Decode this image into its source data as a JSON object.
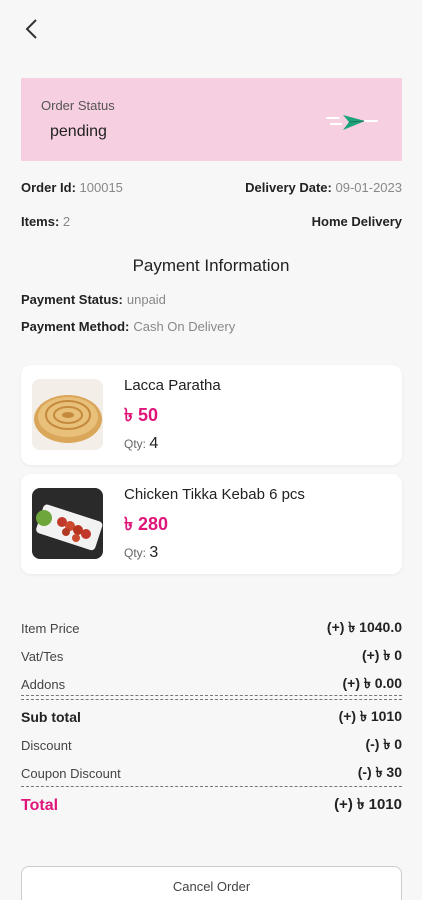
{
  "header": {
    "back_icon": "chevron-left-icon"
  },
  "status": {
    "label": "Order Status",
    "value": "pending",
    "icon": "paper-plane-icon"
  },
  "order": {
    "id_label": "Order Id:",
    "id_value": "100015",
    "date_label": "Delivery Date:",
    "date_value": "09-01-2023",
    "items_label": "Items:",
    "items_value": "2",
    "delivery_type": "Home Delivery"
  },
  "payment": {
    "title": "Payment Information",
    "status_label": "Payment Status:",
    "status_value": "unpaid",
    "method_label": "Payment Method:",
    "method_value": "Cash On Delivery"
  },
  "items": [
    {
      "name": "Lacca Paratha",
      "price": "৳ 50",
      "qty_label": "Qty:",
      "qty": "4"
    },
    {
      "name": "Chicken Tikka Kebab 6 pcs",
      "price": "৳ 280",
      "qty_label": "Qty:",
      "qty": "3"
    }
  ],
  "summary": {
    "item_price": {
      "label": "Item Price",
      "value": "(+) ৳ 1040.0"
    },
    "vat": {
      "label": "Vat/Tes",
      "value": "(+) ৳ 0"
    },
    "addons": {
      "label": "Addons",
      "value": "(+) ৳ 0.00"
    },
    "subtotal": {
      "label": "Sub total",
      "value": "(+) ৳ 1010"
    },
    "discount": {
      "label": "Discount",
      "value": "(-) ৳ 0"
    },
    "coupon": {
      "label": "Coupon Discount",
      "value": "(-) ৳ 30"
    },
    "total": {
      "label": "Total",
      "value": "(+) ৳ 1010"
    }
  },
  "actions": {
    "cancel_label": "Cancel Order"
  },
  "colors": {
    "accent": "#e0157a",
    "status_bg": "#f6cfe0",
    "plane": "#1fa37a"
  }
}
